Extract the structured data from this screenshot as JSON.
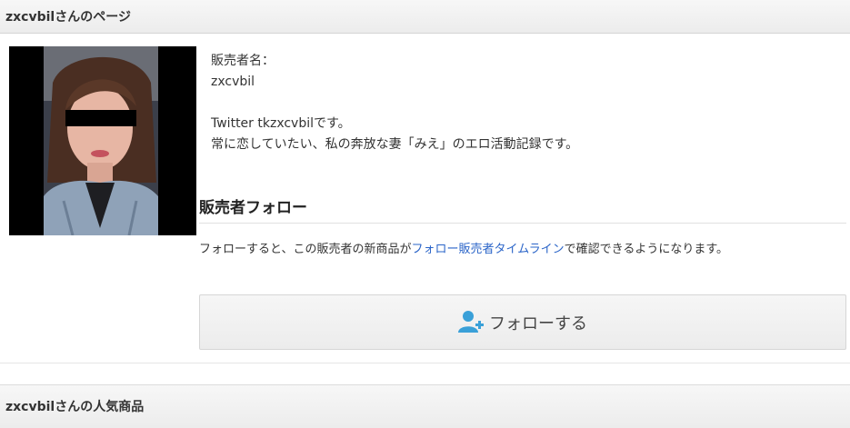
{
  "page_header": {
    "title": "zxcvbilさんのページ"
  },
  "profile": {
    "seller_label": "販売者名：",
    "seller_name": "zxcvbil",
    "bio_line1": "Twitter tkzxcvbilです。",
    "bio_line2": "常に恋していたい、私の奔放な妻「みえ」のエロ活動記録です。"
  },
  "follow": {
    "title": "販売者フォロー",
    "desc_before": "フォローすると、この販売者の新商品が",
    "desc_link": "フォロー販売者タイムライン",
    "desc_after": "で確認できるようになります。",
    "button_label": "フォローする",
    "button_icon": "user-add-icon"
  },
  "popular_header": {
    "title": "zxcvbilさんの人気商品"
  },
  "colors": {
    "link": "#2a64c8",
    "icon_blue": "#3aa0d8",
    "header_bg": "#efefef"
  }
}
